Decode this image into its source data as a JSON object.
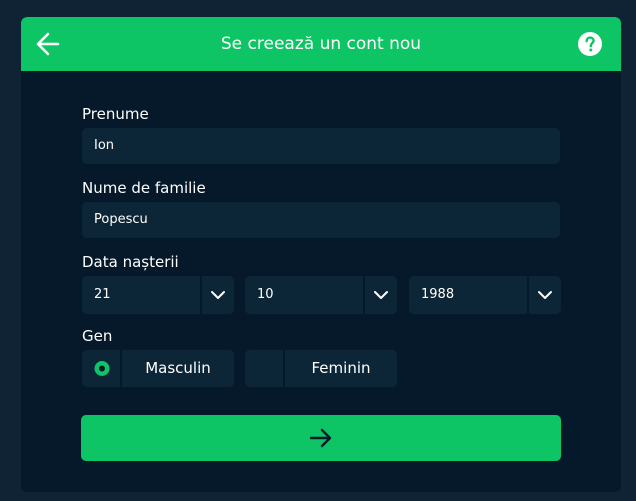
{
  "header": {
    "title": "Se creează un cont nou",
    "back_icon": "arrow-left-icon",
    "help_icon": "help-circle-icon"
  },
  "form": {
    "first_name": {
      "label": "Prenume",
      "value": "Ion"
    },
    "last_name": {
      "label": "Nume de familie",
      "value": "Popescu"
    },
    "birth_date": {
      "label": "Data nașterii",
      "day": "21",
      "month": "10",
      "year": "1988"
    },
    "gender": {
      "label": "Gen",
      "options": [
        {
          "label": "Masculin",
          "selected": true
        },
        {
          "label": "Feminin",
          "selected": false
        }
      ]
    },
    "submit_icon": "arrow-right-icon"
  },
  "colors": {
    "accent": "#0ec566",
    "panel": "#06192a",
    "field": "#0d2637",
    "background": "#0f2334"
  }
}
